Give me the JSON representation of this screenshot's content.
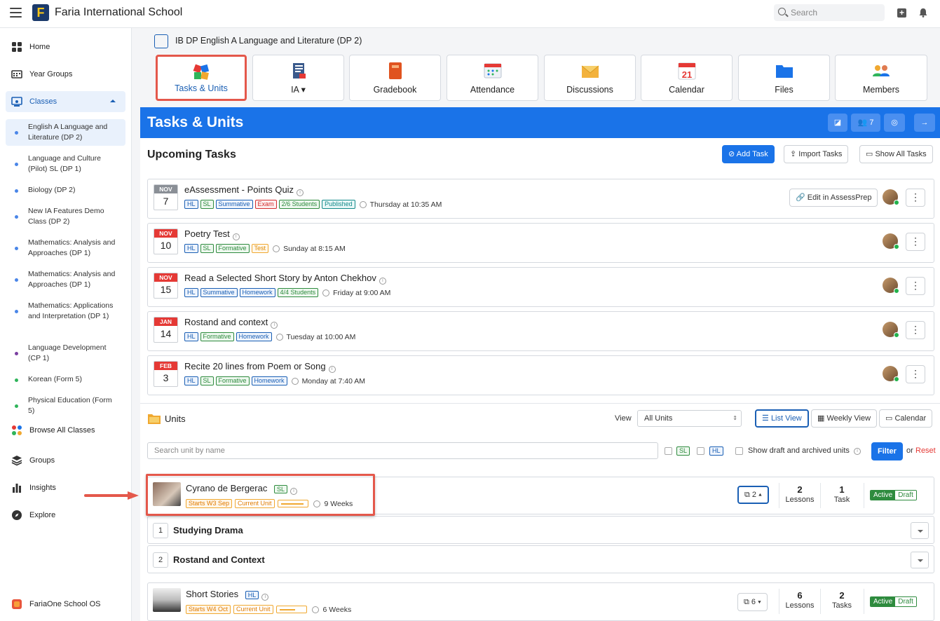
{
  "topbar": {
    "school_name": "Faria International School",
    "logo_letter": "F",
    "search_placeholder": "Search"
  },
  "sidebar": {
    "items": [
      {
        "label": "Home",
        "icon": "grid-icon"
      },
      {
        "label": "Year Groups",
        "icon": "year-groups-icon"
      },
      {
        "label": "Classes",
        "icon": "classes-icon"
      }
    ],
    "classes": [
      {
        "label": "English A Language and Literature (DP 2)",
        "dot": "#4a86e8"
      },
      {
        "label": "Language and Culture (Pilot) SL (DP 1)",
        "dot": "#4a86e8"
      },
      {
        "label": "Biology (DP 2)",
        "dot": "#4a86e8"
      },
      {
        "label": "New IA Features Demo Class (DP 2)",
        "dot": "#4a86e8"
      },
      {
        "label": "Mathematics: Analysis and Approaches (DP 1)",
        "dot": "#4a86e8"
      },
      {
        "label": "Mathematics: Analysis and Approaches (DP 1)",
        "dot": "#4a86e8"
      },
      {
        "label": "Mathematics: Applications and Interpretation (DP 1)",
        "dot": "#4a86e8"
      },
      {
        "label": "Language Development (CP 1)",
        "dot": "#7b3fa0"
      },
      {
        "label": "Korean (Form 5)",
        "dot": "#2fb45a"
      },
      {
        "label": "Physical Education (Form 5)",
        "dot": "#2fb45a"
      }
    ],
    "bottom_items": [
      {
        "label": "Browse All Classes",
        "icon": "browse-classes-icon"
      },
      {
        "label": "Groups",
        "icon": "groups-icon"
      },
      {
        "label": "Insights",
        "icon": "insights-icon"
      },
      {
        "label": "Explore",
        "icon": "explore-icon"
      }
    ],
    "footer": "FariaOne School OS"
  },
  "course": {
    "title": "IB DP English A Language and Literature (DP 2)",
    "tiles": [
      {
        "label": "Tasks & Units",
        "icon": "puzzle-icon"
      },
      {
        "label": "IA",
        "icon": "ia-icon"
      },
      {
        "label": "Gradebook",
        "icon": "gradebook-icon"
      },
      {
        "label": "Attendance",
        "icon": "attendance-icon"
      },
      {
        "label": "Discussions",
        "icon": "discussions-icon"
      },
      {
        "label": "Calendar",
        "icon": "calendar-icon",
        "day": "21"
      },
      {
        "label": "Files",
        "icon": "folder-icon"
      },
      {
        "label": "Members",
        "icon": "members-icon"
      }
    ]
  },
  "banner": {
    "title": "Tasks & Units",
    "members_count": "7"
  },
  "upcoming": {
    "heading": "Upcoming Tasks",
    "add_task": "Add Task",
    "import_tasks": "Import Tasks",
    "show_all": "Show All Tasks",
    "tasks": [
      {
        "month": "NOV",
        "day": "7",
        "title": "eAssessment - Points Quiz",
        "when": "Thursday at 10:35 AM",
        "extra": "Edit in AssessPrep",
        "tags": [
          {
            "t": "HL",
            "c": "t-hl"
          },
          {
            "t": "SL",
            "c": "t-sl"
          },
          {
            "t": "Summative",
            "c": "t-sum"
          },
          {
            "t": "Exam",
            "c": "t-exam"
          },
          {
            "t": "2/6 Students",
            "c": "t-stu"
          },
          {
            "t": "Published",
            "c": "t-pub"
          }
        ]
      },
      {
        "month": "NOV",
        "day": "10",
        "title": "Poetry Test",
        "when": "Sunday at 8:15 AM",
        "tags": [
          {
            "t": "HL",
            "c": "t-hl"
          },
          {
            "t": "SL",
            "c": "t-sl"
          },
          {
            "t": "Formative",
            "c": "t-form"
          },
          {
            "t": "Test",
            "c": "t-test"
          }
        ]
      },
      {
        "month": "NOV",
        "day": "15",
        "title": "Read a Selected Short Story by Anton Chekhov",
        "when": "Friday at 9:00 AM",
        "tags": [
          {
            "t": "HL",
            "c": "t-hl"
          },
          {
            "t": "Summative",
            "c": "t-sum"
          },
          {
            "t": "Homework",
            "c": "t-hw"
          },
          {
            "t": "4/4 Students",
            "c": "t-stu"
          }
        ]
      },
      {
        "month": "JAN",
        "day": "14",
        "title": "Rostand and context",
        "when": "Tuesday at 10:00 AM",
        "tags": [
          {
            "t": "HL",
            "c": "t-hl"
          },
          {
            "t": "Formative",
            "c": "t-form"
          },
          {
            "t": "Homework",
            "c": "t-hw"
          }
        ]
      },
      {
        "month": "FEB",
        "day": "3",
        "title": "Recite 20 lines from Poem or Song",
        "when": "Monday at 7:40 AM",
        "tags": [
          {
            "t": "HL",
            "c": "t-hl"
          },
          {
            "t": "SL",
            "c": "t-sl"
          },
          {
            "t": "Formative",
            "c": "t-form"
          },
          {
            "t": "Homework",
            "c": "t-hw"
          }
        ]
      }
    ]
  },
  "units": {
    "heading": "Units",
    "view_label": "View",
    "view_value": "All Units",
    "list_view": "List View",
    "weekly_view": "Weekly View",
    "calendar": "Calendar",
    "search_placeholder": "Search unit by name",
    "sl": "SL",
    "hl": "HL",
    "show_draft": "Show draft and archived units",
    "filter": "Filter",
    "or": "or",
    "reset": "Reset",
    "items": [
      {
        "name": "Cyrano de Bergerac",
        "level": "SL",
        "start": "Starts W3 Sep",
        "current": "Current Unit",
        "progress": 0.9,
        "weeks": "9 Weeks",
        "stack": "2",
        "lessons": "2",
        "lessons_label": "Lessons",
        "tasks": "1",
        "tasks_label": "Task",
        "active": "Active",
        "draft": "Draft",
        "lesson_rows": [
          {
            "n": "1",
            "title": "Studying Drama"
          },
          {
            "n": "2",
            "title": "Rostand and Context"
          }
        ]
      },
      {
        "name": "Short Stories",
        "level": "HL",
        "start": "Starts W4 Oct",
        "current": "Current Unit",
        "progress": 0.6,
        "weeks": "6 Weeks",
        "stack": "6",
        "lessons": "6",
        "lessons_label": "Lessons",
        "tasks": "2",
        "tasks_label": "Tasks",
        "active": "Active",
        "draft": "Draft"
      }
    ]
  }
}
